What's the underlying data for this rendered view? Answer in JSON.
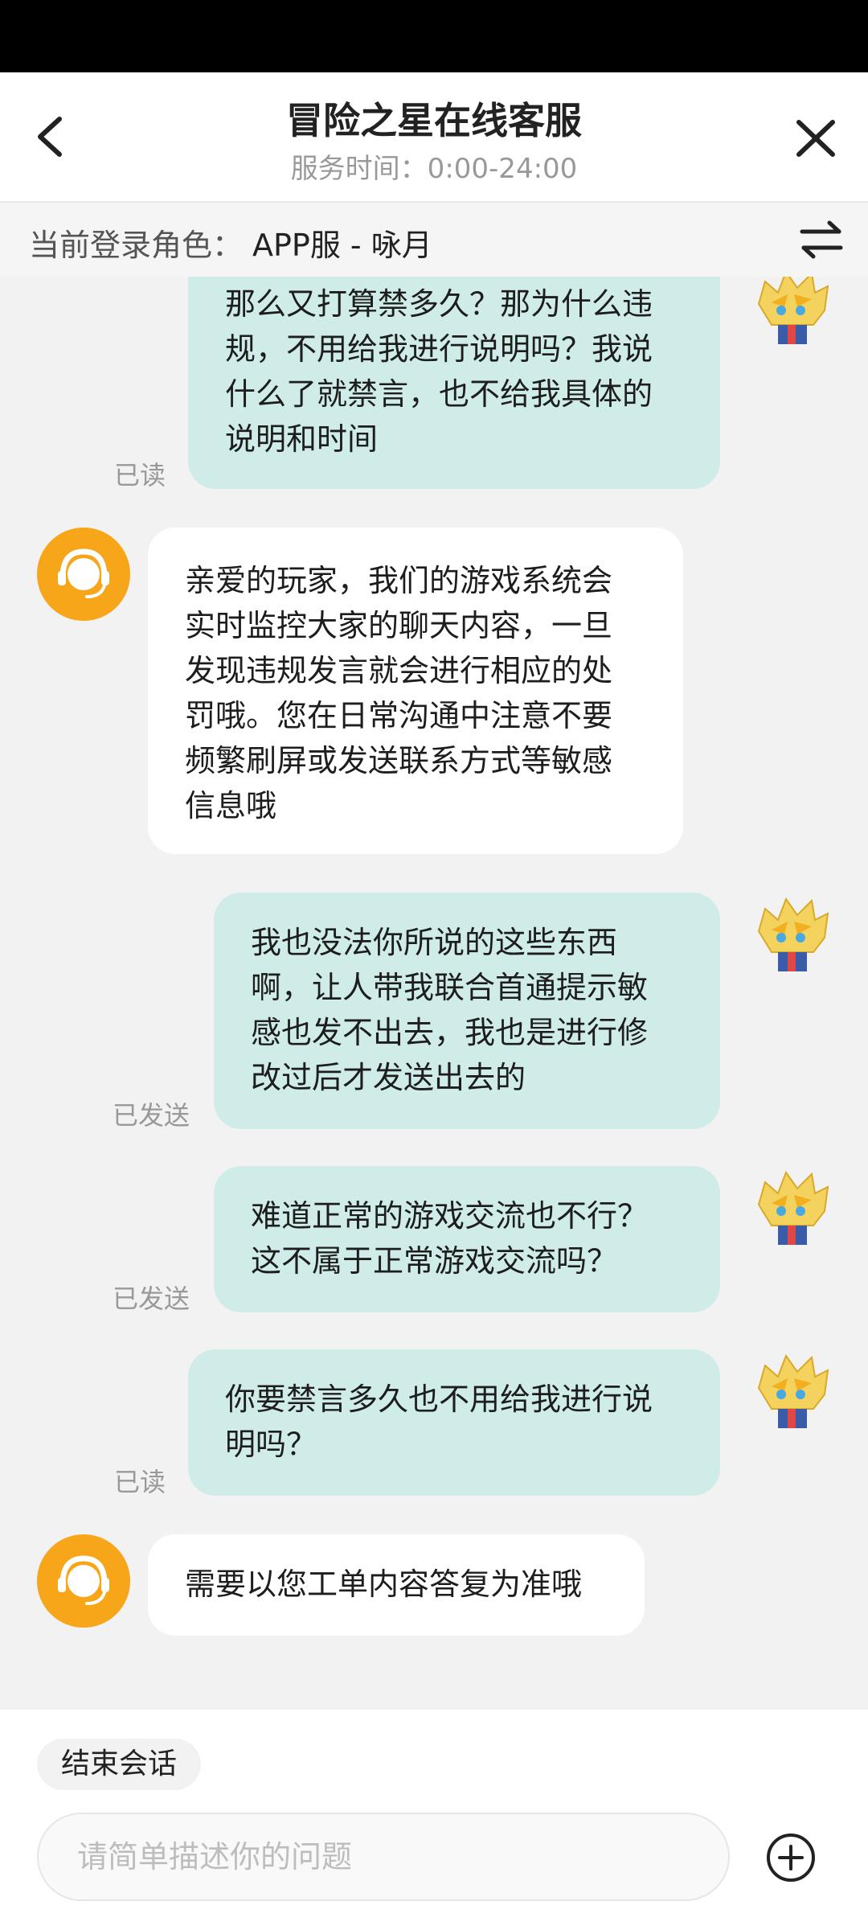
{
  "header": {
    "title": "冒险之星在线客服",
    "service_hours": "服务时间：0:00-24:00"
  },
  "role_bar": {
    "label": "当前登录角色：",
    "value": "APP服 - 咏月"
  },
  "messages": [
    {
      "sender": "user",
      "status": "已读",
      "lines": [
        "那么又打算禁多久？那为什么违",
        "规，不用给我进行说明吗？我说",
        "什么了就禁言，也不给我具体的",
        "说明和时间"
      ]
    },
    {
      "sender": "agent",
      "lines": [
        "亲爱的玩家，我们的游戏系统会",
        "实时监控大家的聊天内容，一旦",
        "发现违规发言就会进行相应的处",
        "罚哦。您在日常沟通中注意不要",
        "频繁刷屏或发送联系方式等敏感",
        "信息哦"
      ]
    },
    {
      "sender": "user",
      "status": "已发送",
      "lines": [
        "我也没法你所说的这些东西",
        "啊，让人带我联合首通提示敏",
        "感也发不出去，我也是进行修",
        "改过后才发送出去的"
      ]
    },
    {
      "sender": "user",
      "status": "已发送",
      "lines": [
        "难道正常的游戏交流也不行？",
        "这不属于正常游戏交流吗？"
      ]
    },
    {
      "sender": "user",
      "status": "已读",
      "lines": [
        "你要禁言多久也不用给我进行说",
        "明吗？"
      ]
    },
    {
      "sender": "agent",
      "lines": [
        "需要以您工单内容答复为准哦"
      ]
    }
  ],
  "footer": {
    "end_session_label": "结束会话",
    "input_placeholder": "请简单描述你的问题",
    "input_value": ""
  },
  "colors": {
    "user_bubble": "#cfece8",
    "agent_bubble": "#ffffff",
    "agent_avatar": "#f7a519",
    "status_bar": "#000000"
  },
  "icons": {
    "back": "chevron-left-icon",
    "close": "close-icon",
    "switch_role": "swap-arrows-icon",
    "agent_avatar": "headset-agent-icon",
    "user_avatar": "spiky-hair-character-icon",
    "add": "plus-circle-icon"
  }
}
